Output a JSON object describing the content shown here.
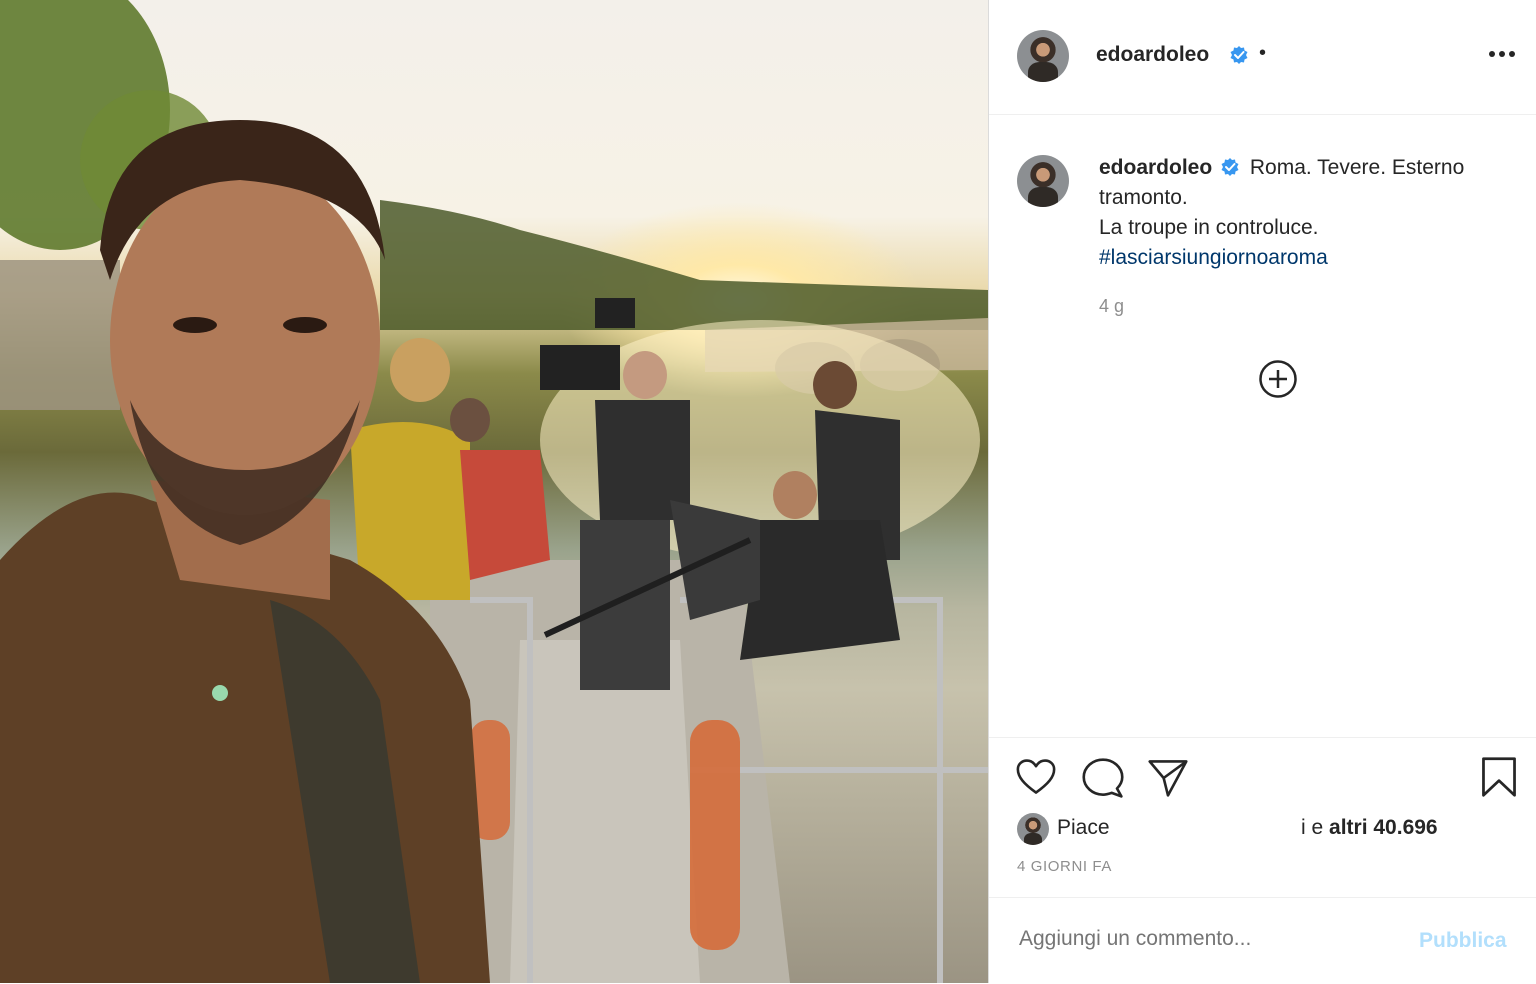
{
  "post": {
    "author": "edoardoleo",
    "header_dot": "•",
    "caption": {
      "username": "edoardoleo",
      "line1": "Roma. Tevere. Esterno tramonto.",
      "line2": "La troupe in controluce.",
      "hashtag": "#lasciarsiungiornoaroma"
    },
    "relative_time": "4 g",
    "likes": {
      "prefix": "Piace",
      "middle": "i e",
      "others": "altri 40.696"
    },
    "date": "4 GIORNI FA"
  },
  "comment": {
    "placeholder": "Aggiungi un commento...",
    "publish_label": "Pubblica"
  },
  "icons": {
    "verified": "verified-badge-icon",
    "more": "more-options-icon",
    "add": "add-circle-icon",
    "like": "heart-icon",
    "comment": "comment-bubble-icon",
    "share": "paper-plane-icon",
    "save": "bookmark-icon"
  },
  "colors": {
    "verified_blue": "#3897f0",
    "hashtag": "#00376b",
    "muted": "#8e8e8e",
    "publish_disabled": "#b2dffc"
  }
}
